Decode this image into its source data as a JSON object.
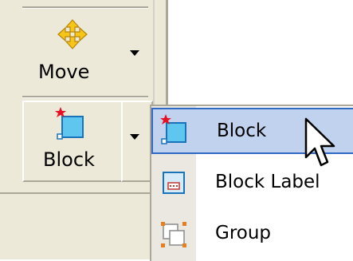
{
  "toolbar": {
    "move": {
      "label": "Move",
      "icon": "move-icon"
    },
    "block": {
      "label": "Block",
      "icon": "block-icon"
    }
  },
  "menu": {
    "items": [
      {
        "label": "Block",
        "icon": "block-icon",
        "highlighted": true
      },
      {
        "label": "Block Label",
        "icon": "block-label-icon",
        "highlighted": false
      },
      {
        "label": "Group",
        "icon": "group-icon",
        "highlighted": false
      }
    ]
  },
  "colors": {
    "toolbar_bg": "#ece9d8",
    "menu_highlight_bg": "#c1d2ee",
    "menu_highlight_border": "#316ac5",
    "icon_blue": "#1ba1e2",
    "icon_red_star": "#e81123"
  }
}
